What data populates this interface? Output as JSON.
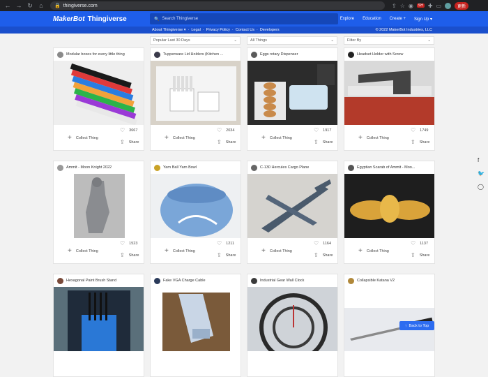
{
  "browser": {
    "url": "thingiverse.com",
    "update_label": "更新",
    "ext_badge": "SH"
  },
  "header": {
    "logo_brand": "MakerBot",
    "logo_product": "Thingiverse",
    "search_placeholder": "Search Thingiverse",
    "nav": [
      "Explore",
      "Education",
      "Create +",
      "Sign Up ▾"
    ]
  },
  "subbar": {
    "links": [
      "About Thingiverse ▾",
      "·",
      "Legal",
      "·",
      "Privacy Policy",
      "·",
      "Contact Us",
      "·",
      "Developers"
    ],
    "copyright": "© 2022 MakerBot Industries, LLC"
  },
  "filters": [
    "Popular Last 30 Days",
    "All Things",
    "Filter By"
  ],
  "cards": [
    {
      "title": "Modular boxes for every little thing",
      "likes": "3667",
      "collect": "Collect Thing",
      "share": "Share",
      "avatar": "#8a8a8a",
      "img": "boxes"
    },
    {
      "title": "Tupperware Lid Holders (Kitchen ...",
      "likes": "2034",
      "collect": "Collect Thing",
      "share": "Share",
      "avatar": "#3a3a4a",
      "img": "lids"
    },
    {
      "title": "Eggs rotary Dispenser",
      "likes": "1917",
      "collect": "Collect Thing",
      "share": "Share",
      "avatar": "#5a5a5a",
      "img": "eggs"
    },
    {
      "title": "Headset Holder with Screw",
      "likes": "1749",
      "collect": "Collect Thing",
      "share": "Share",
      "avatar": "#222",
      "img": "headset"
    },
    {
      "title": "Ammit - Moon Knight 2022",
      "likes": "1523",
      "collect": "Collect Thing",
      "share": "Share",
      "avatar": "#999",
      "img": "ammit"
    },
    {
      "title": "Yarn Ball Yarn Bowl",
      "likes": "1211",
      "collect": "Collect Thing",
      "share": "Share",
      "avatar": "#c9a227",
      "img": "yarn"
    },
    {
      "title": "C-130 Hercules Cargo Plane",
      "likes": "1164",
      "collect": "Collect Thing",
      "share": "Share",
      "avatar": "#666",
      "img": "plane"
    },
    {
      "title": "Egyptian Scarab of Ammit - Moo...",
      "likes": "1137",
      "collect": "Collect Thing",
      "share": "Share",
      "avatar": "#555",
      "img": "scarab"
    },
    {
      "title": "Hexagonal Paint Brush Stand",
      "likes": "",
      "collect": "",
      "share": "",
      "avatar": "#7a4a3a",
      "img": "brush"
    },
    {
      "title": "Fake VGA Charge Cable",
      "likes": "",
      "collect": "",
      "share": "",
      "avatar": "#2a3a5a",
      "img": "vga"
    },
    {
      "title": "Industrial Gear Wall Clock",
      "likes": "",
      "collect": "",
      "share": "",
      "avatar": "#3a3a3a",
      "img": "clock"
    },
    {
      "title": "Collapsible Katana V2",
      "likes": "",
      "collect": "",
      "share": "",
      "avatar": "#b0883a",
      "img": "katana"
    }
  ],
  "social": [
    "f",
    "🐦",
    "◯"
  ],
  "back_to_top": "Back to Top"
}
